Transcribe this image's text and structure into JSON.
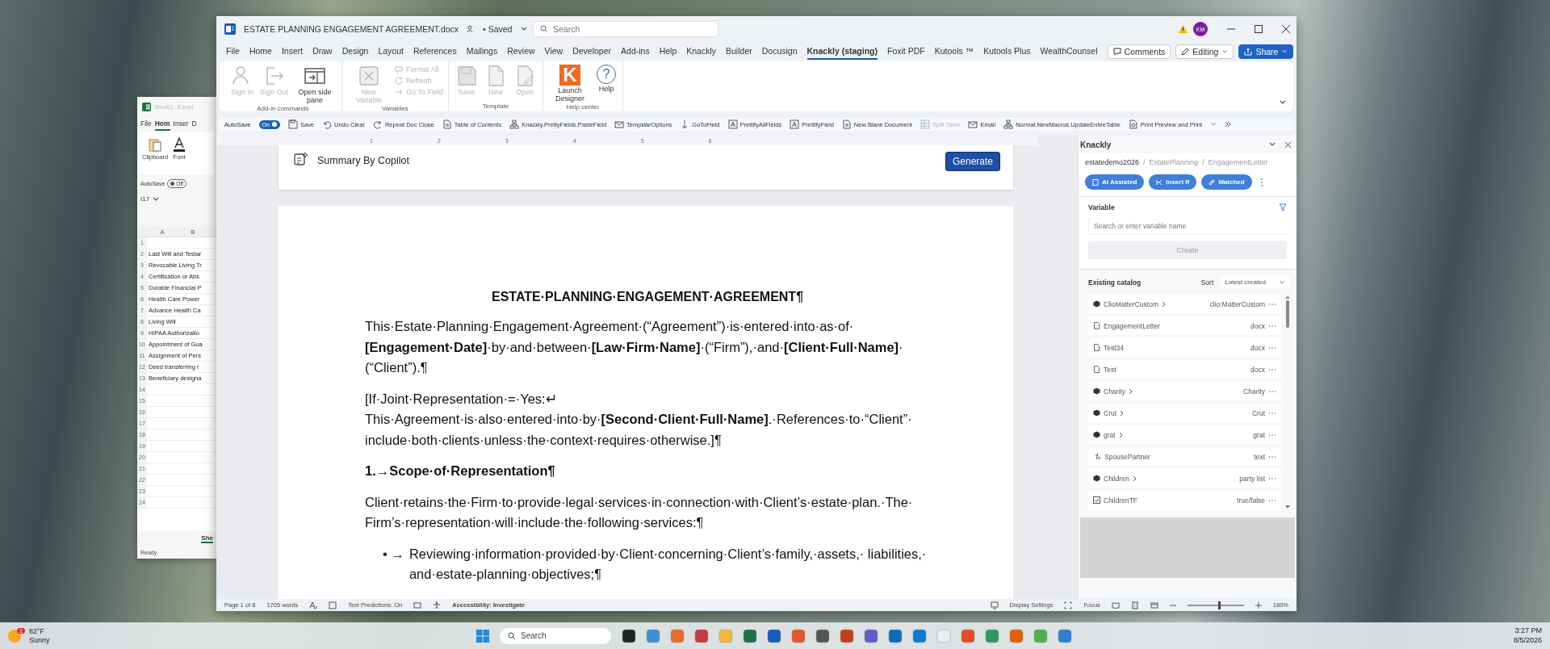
{
  "excel_window": {
    "title": "Book1",
    "app_name": "Excel",
    "tabs": [
      {
        "label": "File",
        "selected": false
      },
      {
        "label": "Hom",
        "selected": true
      },
      {
        "label": "Inser",
        "selected": false
      },
      {
        "label": "D",
        "selected": false
      }
    ],
    "ribbon_groups": [
      "Clipboard",
      "Font"
    ],
    "autosave": {
      "label": "AutoSave",
      "on": false,
      "state_text": "Off"
    },
    "name_box": "I17",
    "columns": [
      "A",
      "B"
    ],
    "rows": [
      {
        "number": "1"
      },
      {
        "number": "2",
        "cell": "Last Will and Testar"
      },
      {
        "number": "3",
        "cell": "Revocable Living Tr"
      },
      {
        "number": "4",
        "cell": "Certification or Abs"
      },
      {
        "number": "5",
        "cell": "Durable Financial P"
      },
      {
        "number": "6",
        "cell": "Health Care Power"
      },
      {
        "number": "7",
        "cell": "Advance Health Ca"
      },
      {
        "number": "8",
        "cell": "Living Will"
      },
      {
        "number": "9",
        "cell": "HIPAA Authorizatio"
      },
      {
        "number": "10",
        "cell": "Appointment of Gua"
      },
      {
        "number": "11",
        "cell": "Assignment of Pers"
      },
      {
        "number": "12",
        "cell": "Deed transferring r"
      },
      {
        "number": "13",
        "cell": "Beneficiary designa"
      },
      {
        "number": "14"
      },
      {
        "number": "15"
      },
      {
        "number": "16"
      },
      {
        "number": "17"
      },
      {
        "number": "18"
      },
      {
        "number": "19"
      },
      {
        "number": "20"
      },
      {
        "number": "21"
      },
      {
        "number": "22"
      },
      {
        "number": "23"
      },
      {
        "number": "24"
      }
    ],
    "sheet_tab": "She",
    "status": "Ready"
  },
  "word_window": {
    "title": "ESTATE PLANNING ENGAGEMENT AGREEMENT.docx",
    "save_status": "• Saved",
    "search": {
      "placeholder": "Search"
    },
    "avatar_initials": "KM",
    "tabs": [
      {
        "label": "File",
        "selected": false
      },
      {
        "label": "Home",
        "selected": false
      },
      {
        "label": "Insert",
        "selected": false
      },
      {
        "label": "Draw",
        "selected": false
      },
      {
        "label": "Design",
        "selected": false
      },
      {
        "label": "Layout",
        "selected": false
      },
      {
        "label": "References",
        "selected": false
      },
      {
        "label": "Mailings",
        "selected": false
      },
      {
        "label": "Review",
        "selected": false
      },
      {
        "label": "View",
        "selected": false
      },
      {
        "label": "Developer",
        "selected": false
      },
      {
        "label": "Add-ins",
        "selected": false
      },
      {
        "label": "Help",
        "selected": false
      },
      {
        "label": "Knackly",
        "selected": false
      },
      {
        "label": "Builder",
        "selected": false
      },
      {
        "label": "Docusign",
        "selected": false
      },
      {
        "label": "Knackly (staging)",
        "selected": true
      },
      {
        "label": "Foxit PDF",
        "selected": false
      },
      {
        "label": "Kutools ™",
        "selected": false
      },
      {
        "label": "Kutools Plus",
        "selected": false
      },
      {
        "label": "WealthCounsel",
        "selected": false
      }
    ],
    "actions": [
      {
        "kind": "comments",
        "label": "Comments"
      },
      {
        "kind": "editing",
        "label": "Editing"
      },
      {
        "kind": "share",
        "label": "Share"
      }
    ],
    "ribbon_groups": [
      {
        "label": "Add-in commands",
        "buttons": [
          {
            "kind": "person",
            "label": "Sign In",
            "disabled": true
          },
          {
            "kind": "signout",
            "label": "Sign Out",
            "disabled": true
          },
          {
            "kind": "pane",
            "label": "Open side pane",
            "disabled": false
          }
        ]
      },
      {
        "label": "Variables",
        "buttons": [
          {
            "kind": "variable",
            "label": "New Variable",
            "disabled": true
          }
        ],
        "small_buttons": [
          {
            "kind": "format",
            "label": "Format All",
            "disabled": true
          },
          {
            "kind": "refresh",
            "label": "Refresh",
            "disabled": true
          },
          {
            "kind": "goto",
            "label": "Go To Field",
            "disabled": true
          }
        ]
      },
      {
        "label": "Template",
        "buttons": [
          {
            "kind": "save",
            "label": "Save",
            "disabled": true
          },
          {
            "kind": "new",
            "label": "New",
            "disabled": true
          },
          {
            "kind": "open",
            "label": "Open",
            "disabled": true
          }
        ]
      },
      {
        "label": "Help center",
        "buttons": [
          {
            "kind": "logo",
            "glyph": "K",
            "label": "Launch Designer",
            "disabled": false
          },
          {
            "kind": "help",
            "glyph": "?",
            "label": "Help",
            "disabled": false
          }
        ]
      }
    ],
    "quick_access": {
      "autosave": {
        "label": "AutoSave",
        "on": true,
        "state_text": "On"
      },
      "commands": [
        {
          "kind": "save",
          "label": "Save",
          "disabled": false
        },
        {
          "kind": "undo",
          "label": "Undo Clear",
          "disabled": false
        },
        {
          "kind": "repeat",
          "label": "Repeat Doc Close",
          "disabled": false
        },
        {
          "kind": "doc",
          "label": "Table of Contents",
          "disabled": false
        },
        {
          "kind": "tree",
          "label": "Knackly.PrettyFields.PasteField",
          "disabled": false
        },
        {
          "kind": "envelope",
          "label": "TemplateOptions",
          "disabled": false
        },
        {
          "kind": "down",
          "label": "GoToField",
          "disabled": false
        },
        {
          "kind": "textbox",
          "label": "PrettifyAllFields",
          "disabled": false
        },
        {
          "kind": "textbox",
          "label": "PrettifyField",
          "disabled": false
        },
        {
          "kind": "doc",
          "label": "New Blank Document",
          "disabled": false
        },
        {
          "kind": "table",
          "label": "Split Table",
          "disabled": true
        },
        {
          "kind": "envelope",
          "label": "Email",
          "disabled": false
        },
        {
          "kind": "tree",
          "label": "Normal.NewMacros.UpdateEntireTable",
          "disabled": false
        },
        {
          "kind": "print",
          "label": "Print Preview and Print",
          "disabled": false
        }
      ]
    },
    "ruler_marks": [
      "1",
      "2",
      "3",
      "4",
      "5",
      "6"
    ],
    "copilot": {
      "title": "Summary By Copilot",
      "button": "Generate"
    },
    "document": {
      "title": "ESTATE·PLANNING·ENGAGEMENT·AGREEMENT¶",
      "blocks": [
        {
          "kind": "paragraph",
          "lines": [
            "This·Estate·Planning·Engagement·Agreement·(“Agreement”)·is·entered·into·as·of· **[Engagement·Date]**·by·and·between·**[Law·Firm·Name]**·(“Firm”),·and·**[Client·Full·Name]**·(“Client”).¶"
          ]
        },
        {
          "kind": "paragraph",
          "lines": [
            "[If·Joint·Representation·=·Yes:↵",
            "This·Agreement·is·also·entered·into·by·**[Second·Client·Full·Name]**.·References·to·“Client”· include·both·clients·unless·the·context·requires·otherwise.]¶"
          ]
        },
        {
          "kind": "heading",
          "lines": [
            "1.→Scope·of·Representation¶"
          ]
        },
        {
          "kind": "paragraph",
          "lines": [
            "Client·retains·the·Firm·to·provide·legal·services·in·connection·with·Client’s·estate·plan.·The· Firm’s·representation·will·include·the·following·services:¶"
          ]
        },
        {
          "kind": "bullet",
          "marker": "• →",
          "lines": [
            "Reviewing·information·provided·by·Client·concerning·Client’s·family,·assets,· liabilities,·and·estate-planning·objectives;¶"
          ]
        }
      ]
    },
    "status_bar": {
      "page": "Page 1 of 8",
      "words": "1705 words",
      "predictions": "Text Predictions: On",
      "accessibility": "Accessibility: Investigate",
      "display_settings": "Display Settings",
      "focus": "Focus",
      "zoom": {
        "level": 0.56,
        "reading": "180%"
      }
    }
  },
  "knackly_pane": {
    "title": "Knackly",
    "breadcrumb": [
      "estatedemo2026",
      "EstatePlanning",
      "EngagementLetter"
    ],
    "separator": "/",
    "mode_buttons": [
      {
        "kind": "ai",
        "label": "AI Assisted"
      },
      {
        "kind": "if",
        "label": "Insert If"
      },
      {
        "kind": "link",
        "label": "Matched"
      }
    ],
    "variable_label": "Variable",
    "search": {
      "placeholder": "Search or enter variable name"
    },
    "create_button": {
      "label": "Create",
      "disabled": true
    },
    "catalog_title": "Existing catalog",
    "sort_label": "Sort",
    "sort_value": "Latest created",
    "items": [
      {
        "kind": "object",
        "name": "ClioMatterCustom",
        "expandable": true,
        "type": "clio:MatterCustom"
      },
      {
        "kind": "file",
        "name": "EngagementLetter",
        "expandable": false,
        "type": "docx"
      },
      {
        "kind": "file",
        "name": "Test34",
        "expandable": false,
        "type": "docx"
      },
      {
        "kind": "file",
        "name": "Test",
        "expandable": false,
        "type": "docx"
      },
      {
        "kind": "object",
        "name": "Charity",
        "expandable": true,
        "type": "Charity"
      },
      {
        "kind": "object",
        "name": "Crut",
        "expandable": true,
        "type": "Crut"
      },
      {
        "kind": "object",
        "name": "grat",
        "expandable": true,
        "type": "grat"
      },
      {
        "kind": "formula",
        "name": "SpousePartner",
        "expandable": false,
        "type": "text"
      },
      {
        "kind": "object",
        "name": "Children",
        "expandable": true,
        "type": "party list"
      },
      {
        "kind": "check",
        "name": "ChildrenTF",
        "expandable": false,
        "type": "true/false"
      }
    ]
  },
  "taskbar": {
    "weather": {
      "badge": "1",
      "temperature": "82°F",
      "condition": "Sunny"
    },
    "search": {
      "placeholder": "Search"
    },
    "clock": {
      "time": "3:27 PM",
      "date": "8/5/2026"
    }
  }
}
